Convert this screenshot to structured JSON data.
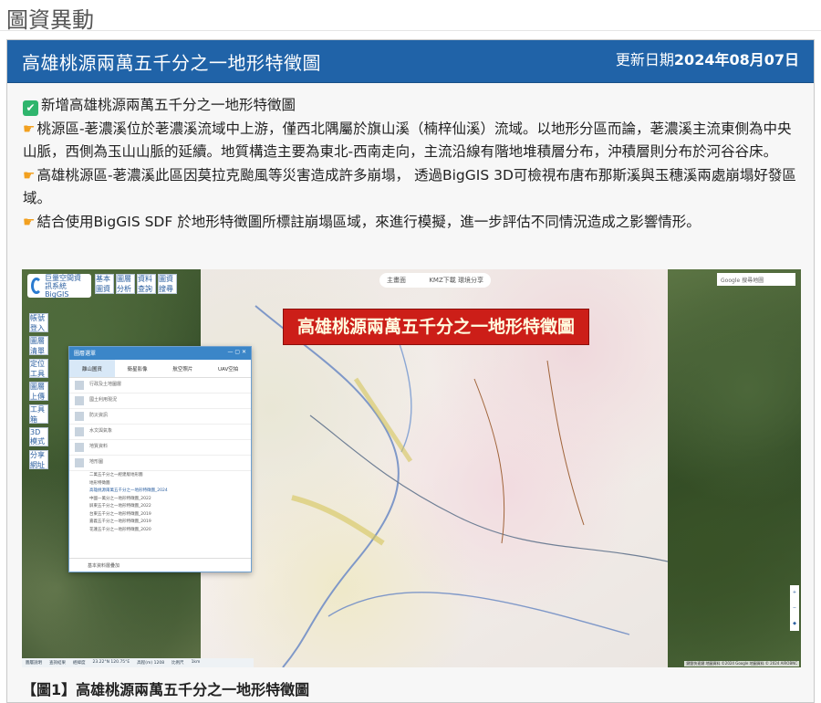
{
  "page": {
    "heading": "圖資異動"
  },
  "card": {
    "title": "高雄桃源兩萬五千分之一地形特徵圖",
    "date_label": "更新日期",
    "date_value": "2024年08月07日"
  },
  "body": {
    "line1": "新增高雄桃源兩萬五千分之一地形特徵圖",
    "line2": "桃源區-荖濃溪位於荖濃溪流域中上游，僅西北隅屬於旗山溪（楠梓仙溪）流域。以地形分區而論，荖濃溪主流東側為中央山脈，西側為玉山山脈的延續。地質構造主要為東北-西南走向，主流沿線有階地堆積層分布，沖積層則分布於河谷谷床。",
    "line3": "高雄桃源區-荖濃溪此區因莫拉克颱風等災害造成許多崩塌， 透過BigGIS 3D可檢視布唐布那斯溪與玉穗溪兩處崩塌好發區域。",
    "line4": "結合使用BigGIS SDF 於地形特徵圖所標註崩塌區域，來進行模擬，進一步評估不同情況造成之影響情形。"
  },
  "figure": {
    "banner": "高雄桃源兩萬五千分之一地形特徵圖",
    "logo_text": "巨量空間資訊系統 BigGIS",
    "top_tools": [
      "基本圖資",
      "圖層分析",
      "資料查詢",
      "圖資搜尋"
    ],
    "side_tools": [
      "帳號登入",
      "圖層清單",
      "定位工具",
      "圖層上傳",
      "工具箱",
      "3D模式",
      "分享網址"
    ],
    "search_left": "主畫面",
    "search_right": "KMZ下載   環境分享",
    "gmap_search": "Google 搜尋地圖",
    "layer_panel": {
      "title": "圖層選單",
      "tabs": [
        "離山圖資",
        "衛星影像",
        "航空照片",
        "UAV空拍"
      ],
      "rows": [
        "行政及土地圖層",
        "國土利用現況",
        "防災資訊",
        "水文與氣象",
        "地質資料",
        "地形圖"
      ],
      "sub_items": [
        "二萬五千分之一經建版地形圖",
        "地形特徵圖",
        "高雄桃源兩萬五千分之一地形特徵圖_2024",
        "中國一萬分之一地形特徵圖_2022",
        "屏東五千分之一地形特徵圖_2022",
        "台東五千分之一地形特徵圖_2019",
        "嘉義五千分之一地形特徵圖_2019",
        "花蓮五千分之一地形特徵圖_2020"
      ],
      "footer": "基本資料層疊加"
    },
    "status": [
      "圖層說明",
      "查詢結果",
      "經緯度",
      "23.22°N 120.75°E",
      "高程(m) 1208",
      "比例尺",
      "1km"
    ],
    "attribution": "鍵盤快速鍵  地圖資料 ©2024 Google  地圖資料 © 2024 AIROBNC"
  },
  "caption": "【圖1】高雄桃源兩萬五千分之一地形特徵圖"
}
